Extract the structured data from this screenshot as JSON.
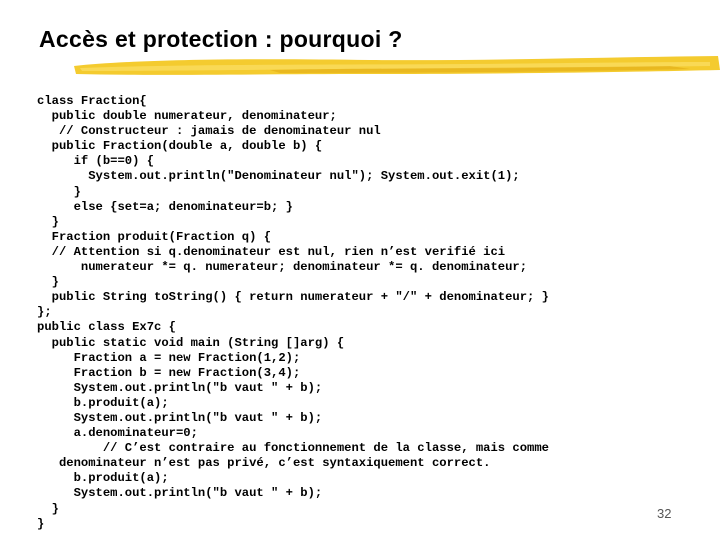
{
  "slide": {
    "title": "Accès et protection : pourquoi ?",
    "page_number": "32",
    "accent_color": "#F2C417",
    "code_lines": [
      "class Fraction{",
      "  public double numerateur, denominateur;",
      "   // Constructeur : jamais de denominateur nul",
      "  public Fraction(double a, double b) {",
      "     if (b==0) {",
      "       System.out.println(\"Denominateur nul\"); System.out.exit(1);",
      "     }",
      "     else {set=a; denominateur=b; }",
      "  }",
      "  Fraction produit(Fraction q) {",
      "  // Attention si q.denominateur est nul, rien n’est verifié ici",
      "      numerateur *= q. numerateur; denominateur *= q. denominateur;",
      "  }",
      "  public String toString() { return numerateur + \"/\" + denominateur; }",
      "};",
      "public class Ex7c {",
      "  public static void main (String []arg) {",
      "     Fraction a = new Fraction(1,2);",
      "     Fraction b = new Fraction(3,4);",
      "     System.out.println(\"b vaut \" + b);",
      "     b.produit(a);",
      "     System.out.println(\"b vaut \" + b);",
      "     a.denominateur=0;",
      "         // C’est contraire au fonctionnement de la classe, mais comme",
      "   denominateur n’est pas privé, c’est syntaxiquement correct.",
      "     b.produit(a);",
      "     System.out.println(\"b vaut \" + b);",
      "  }",
      "}"
    ]
  }
}
